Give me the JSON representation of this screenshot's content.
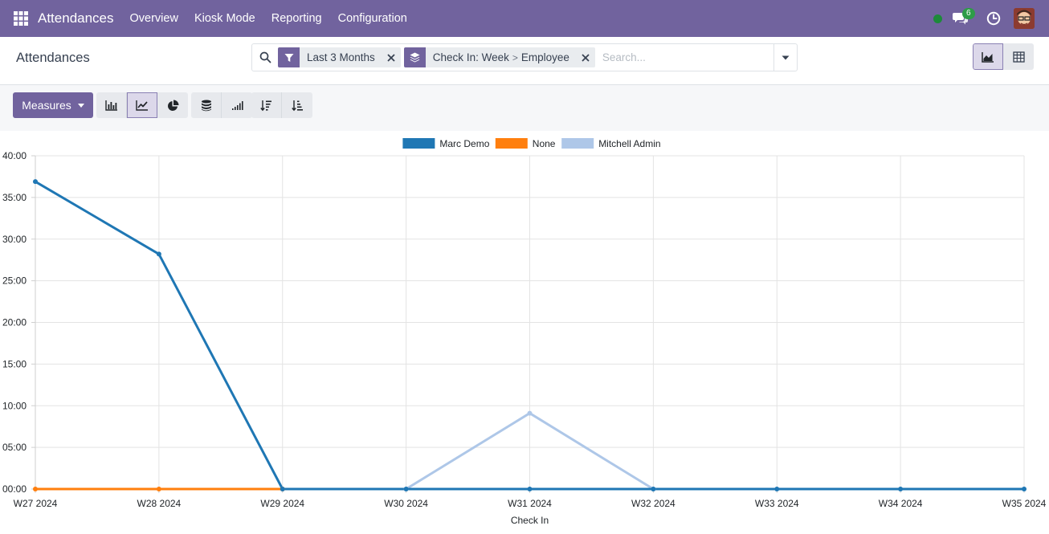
{
  "navbar": {
    "app_title": "Attendances",
    "menu": [
      "Overview",
      "Kiosk Mode",
      "Reporting",
      "Configuration"
    ],
    "chat_badge": "6",
    "colors": {
      "navbar": "#71639e",
      "presence": "#1d8a3a",
      "badge": "#2e9c48"
    }
  },
  "control_panel": {
    "breadcrumb": "Attendances",
    "facets": [
      {
        "icon": "filter-icon",
        "label": "Last 3 Months"
      },
      {
        "icon": "group-by-icon",
        "group": [
          "Check In: Week",
          "Employee"
        ]
      }
    ],
    "search_placeholder": "Search...",
    "views": [
      "graph-view",
      "pivot-view"
    ],
    "active_view": "graph-view"
  },
  "toolbar": {
    "measures_label": "Measures",
    "chart_types": [
      "bar-chart-icon",
      "line-chart-icon",
      "pie-chart-icon"
    ],
    "active_chart_type": "line-chart-icon",
    "line_options": [
      "stacked-icon",
      "cumulative-icon"
    ],
    "sort_options": [
      "sort-descending-icon",
      "sort-ascending-icon"
    ]
  },
  "chart_data": {
    "type": "line",
    "xlabel": "Check In",
    "ylabel": "",
    "x": [
      "W27 2024",
      "W28 2024",
      "W29 2024",
      "W30 2024",
      "W31 2024",
      "W32 2024",
      "W33 2024",
      "W34 2024",
      "W35 2024"
    ],
    "y_ticks": [
      "00:00",
      "05:00",
      "10:00",
      "15:00",
      "20:00",
      "25:00",
      "30:00",
      "35:00",
      "40:00"
    ],
    "ylim": [
      0,
      40
    ],
    "grid": true,
    "legend_position": "top",
    "series": [
      {
        "name": "Marc Demo",
        "color": "#1f77b4",
        "values": [
          36.9,
          28.2,
          0,
          0,
          0,
          0,
          0,
          0,
          0
        ]
      },
      {
        "name": "None",
        "color": "#ff7f0e",
        "values": [
          0,
          0,
          0,
          null,
          null,
          null,
          null,
          null,
          null
        ]
      },
      {
        "name": "Mitchell Admin",
        "color": "#aec7e8",
        "values": [
          null,
          null,
          null,
          0,
          9.1,
          0,
          null,
          null,
          null
        ]
      }
    ]
  }
}
